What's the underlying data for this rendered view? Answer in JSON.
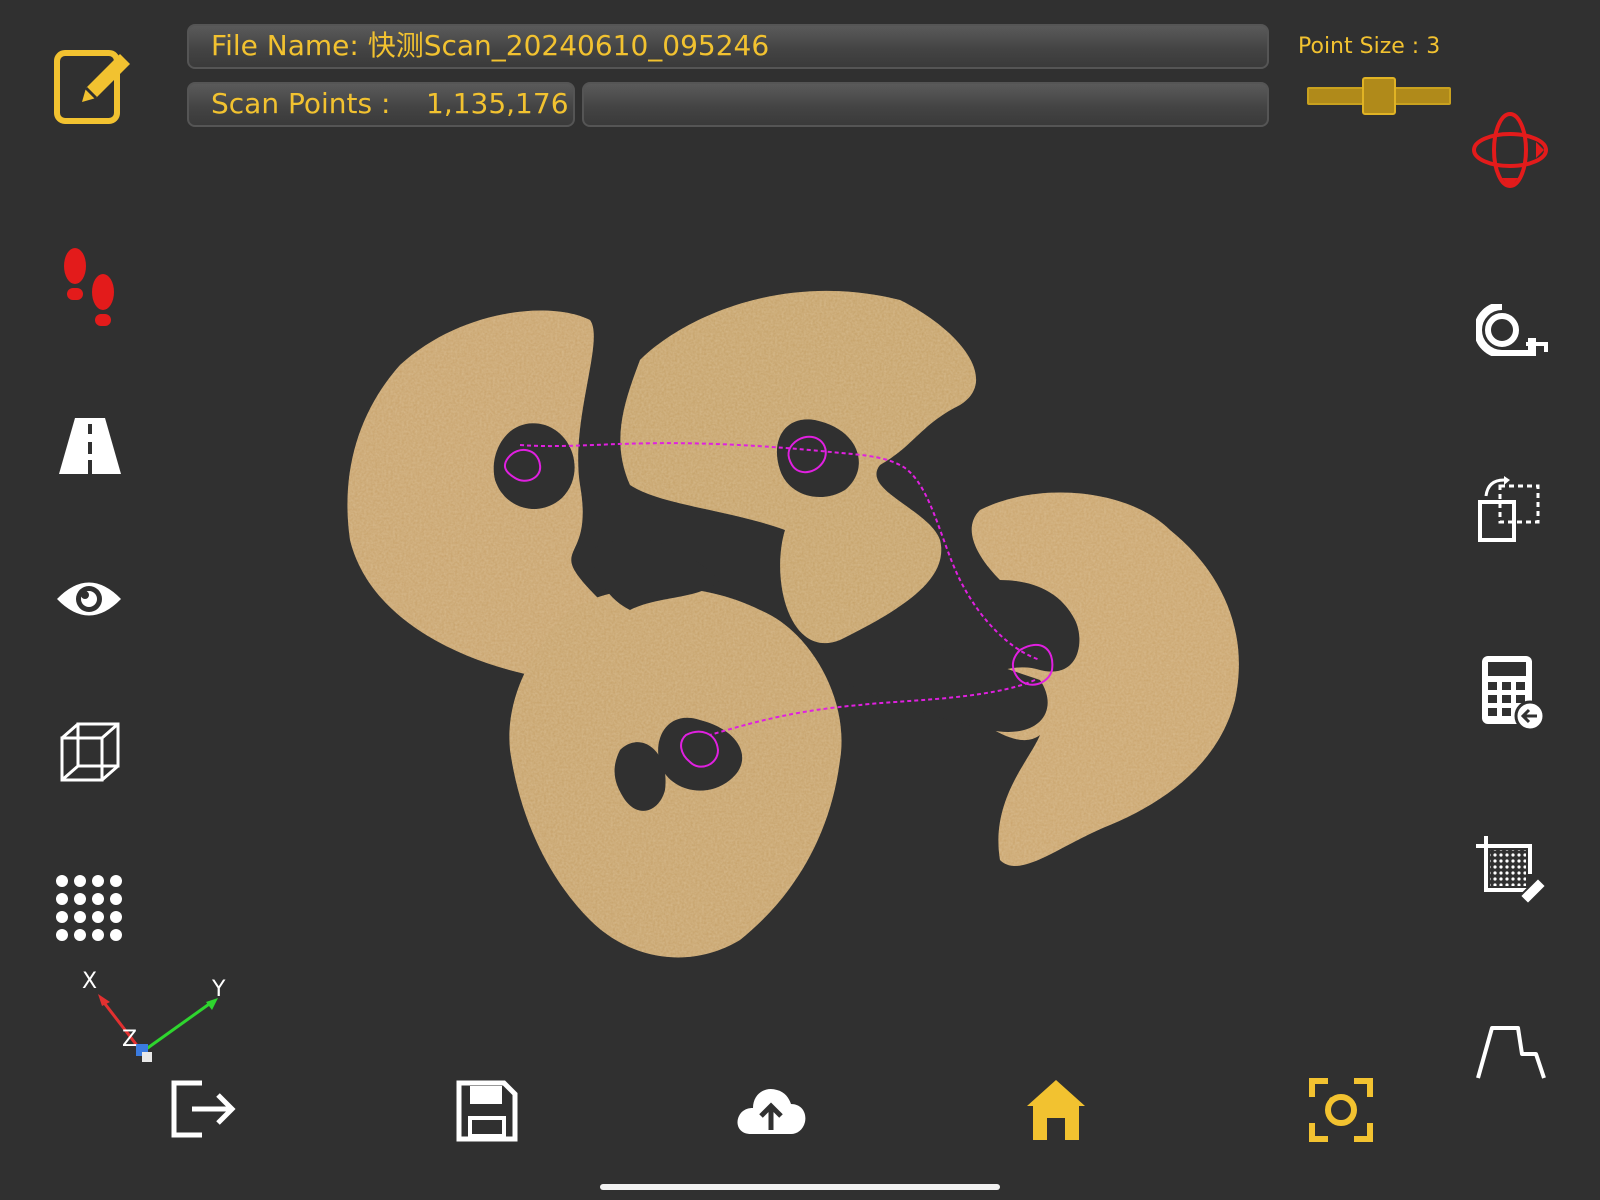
{
  "header": {
    "file_name_label": "File Name:",
    "file_name_value": "快测Scan_20240610_095246",
    "scan_points_label": "Scan Points :",
    "scan_points_value": "1,135,176",
    "point_size_label": "Point Size :",
    "point_size_value": "3"
  },
  "axes": {
    "x": "X",
    "y": "Y",
    "z": "Z"
  },
  "left_toolbar": [
    {
      "icon": "edit-icon",
      "color": "#f2c230"
    },
    {
      "icon": "footprints-icon",
      "color": "#e31b1b"
    },
    {
      "icon": "road-icon",
      "color": "#ffffff"
    },
    {
      "icon": "eye-icon",
      "color": "#ffffff"
    },
    {
      "icon": "cube-wireframe-icon",
      "color": "#ffffff"
    },
    {
      "icon": "point-grid-icon",
      "color": "#ffffff"
    }
  ],
  "right_toolbar": [
    {
      "icon": "orbit-rotate-icon",
      "color": "#e31b1b"
    },
    {
      "icon": "tape-measure-icon",
      "color": "#ffffff"
    },
    {
      "icon": "transform-icon",
      "color": "#ffffff"
    },
    {
      "icon": "calculator-icon",
      "color": "#ffffff"
    },
    {
      "icon": "crop-erase-icon",
      "color": "#ffffff"
    },
    {
      "icon": "profile-section-icon",
      "color": "#ffffff"
    }
  ],
  "bottom_toolbar": [
    {
      "icon": "exit-icon",
      "color": "#ffffff"
    },
    {
      "icon": "save-icon",
      "color": "#ffffff"
    },
    {
      "icon": "cloud-upload-icon",
      "color": "#ffffff"
    },
    {
      "icon": "home-icon",
      "color": "#f2c230"
    },
    {
      "icon": "screenshot-icon",
      "color": "#f2c230"
    }
  ],
  "colors": {
    "accent": "#f2c230",
    "background": "#303030",
    "scan_texture": "#c9a46a",
    "trajectory": "#e020e0"
  }
}
